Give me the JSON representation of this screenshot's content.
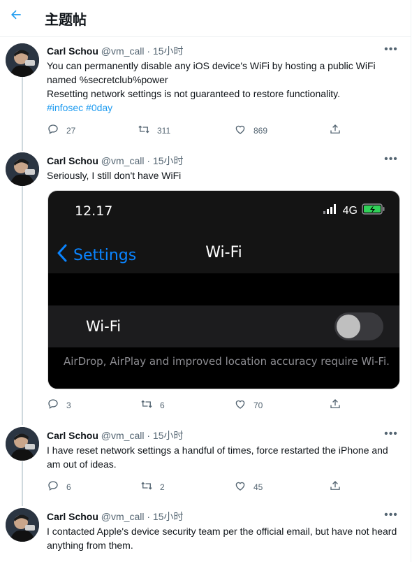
{
  "header": {
    "title": "主题帖"
  },
  "tweets": [
    {
      "name": "Carl Schou",
      "meta": " @vm_call · 15小时",
      "text": "You can permanently disable any iOS device's WiFi by hosting a public WiFi named %secretclub%power\nResetting network settings is not guaranteed to restore functionality.",
      "hashtags": "#infosec #0day",
      "replies": "27",
      "retweets": "311",
      "likes": "869"
    },
    {
      "name": "Carl Schou",
      "meta": " @vm_call · 15小时",
      "text": "Seriously, I still don't have WiFi",
      "replies": "3",
      "retweets": "6",
      "likes": "70"
    },
    {
      "name": "Carl Schou",
      "meta": " @vm_call · 15小时",
      "text": "I have reset network settings a handful of times, force restarted the iPhone and am out of ideas.",
      "replies": "6",
      "retweets": "2",
      "likes": "45"
    },
    {
      "name": "Carl Schou",
      "meta": " @vm_call · 15小时",
      "text": "I contacted Apple's device security team per the official email, but have not heard anything from them."
    }
  ],
  "media": {
    "time": "12.17",
    "network": "4G",
    "back_label": "Settings",
    "nav_title": "Wi-Fi",
    "row_label": "Wi-Fi",
    "footer": "AirDrop, AirPlay and improved location accuracy require Wi-Fi.",
    "wifi_enabled": false
  },
  "colors": {
    "accent": "#1d9bf0",
    "secondary_text": "#536471",
    "ios_blue": "#0a84ff",
    "battery_green": "#30d158"
  },
  "icons": {
    "back": "arrow-left-icon",
    "more": "more-icon",
    "reply": "reply-icon",
    "retweet": "retweet-icon",
    "like": "heart-icon",
    "share": "share-icon"
  }
}
